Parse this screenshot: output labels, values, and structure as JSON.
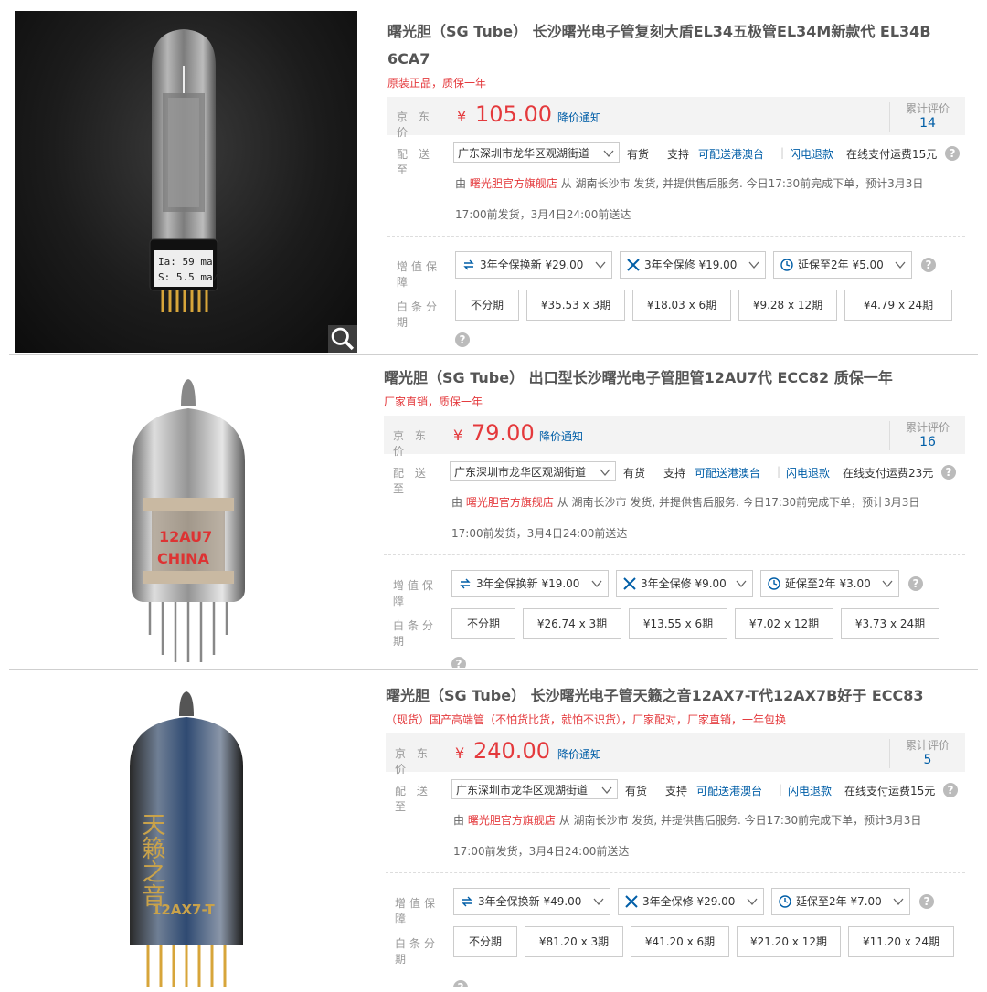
{
  "colors": {
    "price_red": "#e4393c",
    "link_blue": "#005ea7",
    "label_gray": "#999999"
  },
  "labels": {
    "jd_price": "京 东 价",
    "deliver_to": "配 送 至",
    "value_added": "增值保障",
    "installment": "白条分期",
    "currency": "¥",
    "price_alert": "降价通知",
    "rating_label": "累计评价",
    "in_stock": "有货",
    "support": "支持",
    "hk_macau": "可配送港澳台",
    "flash_refund": "闪电退款",
    "help_glyph": "?"
  },
  "products": [
    {
      "title": "曙光胆（SG Tube） 长沙曙光电子管复刻大盾EL34五极管EL34M新款代 EL34B 6CA7",
      "subtitle": "原装正品，质保一年",
      "price": "105.00",
      "rating_count": "14",
      "address": "广东深圳市龙华区观湖街道",
      "shipping_fee": "在线支付运费15元",
      "seller_prefix": "由",
      "seller": "曙光胆官方旗舰店",
      "seller_suffix": "从 湖南长沙市 发货, 并提供售后服务. 今日17:30前完成下单，预计3月3日",
      "delivery": "17:00前发货，3月4日24:00前送达",
      "services": [
        "3年全保换新 ¥29.00",
        "3年全保修 ¥19.00",
        "延保至2年 ¥5.00"
      ],
      "installments": [
        "不分期",
        "¥35.53 x 3期",
        "¥18.03 x 6期",
        "¥9.28 x 12期",
        "¥4.79 x 24期"
      ],
      "tube_print": [
        "Ia: 59 ma",
        "S: 5.5 ma/v"
      ]
    },
    {
      "title": "曙光胆（SG Tube） 出口型长沙曙光电子管胆管12AU7代 ECC82 质保一年",
      "subtitle": "厂家直销，质保一年",
      "price": "79.00",
      "rating_count": "16",
      "address": "广东深圳市龙华区观湖街道",
      "shipping_fee": "在线支付运费23元",
      "seller_prefix": "由",
      "seller": "曙光胆官方旗舰店",
      "seller_suffix": "从 湖南长沙市 发货, 并提供售后服务. 今日17:30前完成下单，预计3月3日",
      "delivery": "17:00前发货，3月4日24:00前送达",
      "services": [
        "3年全保换新 ¥19.00",
        "3年全保修 ¥9.00",
        "延保至2年 ¥3.00"
      ],
      "installments": [
        "不分期",
        "¥26.74 x 3期",
        "¥13.55 x 6期",
        "¥7.02 x 12期",
        "¥3.73 x 24期"
      ],
      "tube_print": [
        "12AU7",
        "CHINA"
      ]
    },
    {
      "title": "曙光胆（SG Tube） 长沙曙光电子管天籁之音12AX7-T代12AX7B好于 ECC83",
      "subtitle": "（现货）国产高端管（不怕货比货，就怕不识货），厂家配对，厂家直销，一年包换",
      "price": "240.00",
      "rating_count": "5",
      "address": "广东深圳市龙华区观湖街道",
      "shipping_fee": "在线支付运费15元",
      "seller_prefix": "由",
      "seller": "曙光胆官方旗舰店",
      "seller_suffix": "从 湖南长沙市 发货, 并提供售后服务. 今日17:30前完成下单，预计3月3日",
      "delivery": "17:00前发货，3月4日24:00前送达",
      "services": [
        "3年全保换新 ¥49.00",
        "3年全保修 ¥29.00",
        "延保至2年 ¥7.00"
      ],
      "installments": [
        "不分期",
        "¥81.20 x 3期",
        "¥41.20 x 6期",
        "¥21.20 x 12期",
        "¥11.20 x 24期"
      ],
      "tube_print": [
        "天籁之音",
        "12AX7-T"
      ]
    }
  ]
}
